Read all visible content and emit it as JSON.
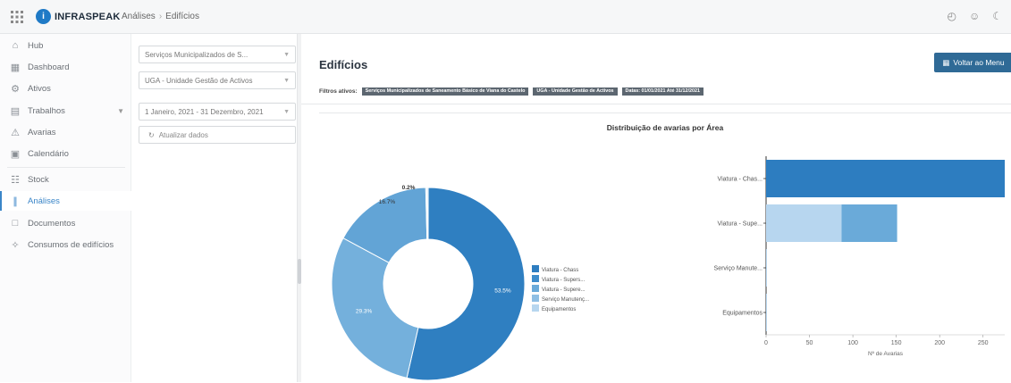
{
  "topbar": {
    "logo_text": "INFRASPEAK",
    "logo_mark": "i",
    "breadcrumb": [
      "Análises",
      "Edifícios"
    ],
    "icons": [
      "grid-icon",
      "time-icon",
      "smile-icon",
      "moon-icon"
    ]
  },
  "sidebar": {
    "items": [
      {
        "label": "Hub",
        "icon": "home-icon"
      },
      {
        "label": "Dashboard",
        "icon": "dashboard-icon"
      },
      {
        "label": "Ativos",
        "icon": "assets-icon"
      },
      {
        "label": "Trabalhos",
        "icon": "work-icon",
        "has_chevron": true
      },
      {
        "label": "Avarias",
        "icon": "warning-icon"
      },
      {
        "label": "Calendário",
        "icon": "calendar-icon"
      },
      {
        "label": "Stock",
        "icon": "stock-icon"
      },
      {
        "label": "Análises",
        "icon": "chart-icon",
        "active": true
      },
      {
        "label": "Documentos",
        "icon": "document-icon"
      },
      {
        "label": "Consumos de edifícios",
        "icon": "energy-icon"
      }
    ]
  },
  "filters": {
    "client": "Serviços Municipalizados de S...",
    "unit": "UGA - Unidade Gestão de Activos",
    "date_range": "1 Janeiro, 2021 - 31 Dezembro, 2021",
    "update_label": "Atualizar dados"
  },
  "main": {
    "title": "Edifícios",
    "back_button": "Voltar ao Menu",
    "filters_label": "Filtros ativos:",
    "filter_chips": [
      "Serviços Municipalizados de Saneamento Básico de Viana do Castelo",
      "UGA - Unidade Gestão de Activos",
      "Datas: 01/01/2021 Até 31/12/2021"
    ]
  },
  "colors": {
    "accent": "#3b86c8",
    "button": "#2f6a96",
    "series": [
      "#2d7dc0",
      "#3d8ccb",
      "#6aaad9",
      "#8fbfe4",
      "#b7d6ef"
    ]
  },
  "chart_data": [
    {
      "type": "pie",
      "donut": true,
      "title": "Distribuição de avarias por Área",
      "labels": [
        "Viatura - Chass",
        "Viatura - Supers...",
        "Viatura - Supere...",
        "Serviço Manutenç...",
        "Equipamentos"
      ],
      "values": [
        53.5,
        29.3,
        16.7,
        0.2,
        0.2
      ],
      "value_labels": [
        "53.5%",
        "29.3%",
        "16.7%",
        "0.2%",
        ""
      ],
      "legend_position": "right"
    },
    {
      "type": "bar",
      "orientation": "horizontal",
      "stacked": true,
      "categories": [
        "Viatura - Chas...",
        "Viatura - Supe...",
        "Serviço Manute...",
        "Equipamentos"
      ],
      "series": [
        {
          "values": [
            275,
            87,
            1,
            1
          ]
        },
        {
          "values": [
            0,
            64,
            0,
            0
          ]
        }
      ],
      "xlabel": "Nº de Avarias",
      "xlim": [
        0,
        275
      ],
      "xticks": [
        0,
        50,
        100,
        150,
        200,
        250
      ],
      "grid": false
    }
  ]
}
